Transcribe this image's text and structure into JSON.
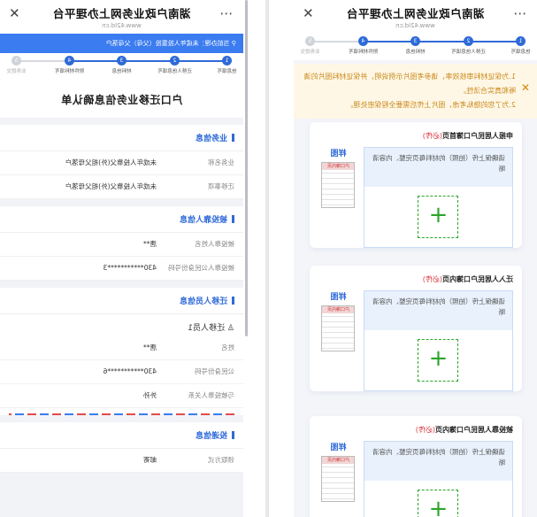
{
  "app": {
    "title": "湖南户政业务网上办理平台",
    "url": "www.42ld.cn"
  },
  "steps": [
    {
      "num": "1",
      "label": "信息填写",
      "done": true
    },
    {
      "num": "2",
      "label": "迁移人信息填写",
      "done": true
    },
    {
      "num": "3",
      "label": "材料信息",
      "done": true
    },
    {
      "num": "4",
      "label": "附件材料填写",
      "done": true
    },
    {
      "num": "5",
      "label": "业务提交",
      "done": false
    }
  ],
  "left": {
    "notice": [
      "1.为保证材料审核效率，请参考图片示例说明，并保证材料图片的清晰和真实合法性。",
      "2.为了您的隐私考虑，图片上传后需要全程保密处理。"
    ],
    "cards": [
      {
        "title": "申报人居民户口簿首页",
        "req": "(必传)",
        "hint": "请确保上传（拍照）的材料每页完整、内容清晰",
        "sample": "样图",
        "doc": "户口簿内页"
      },
      {
        "title": "迁入人居民户口簿内页",
        "req": "(必传)",
        "hint": "请确保上传（拍照）的材料每页完整、内容清晰",
        "sample": "样图",
        "doc": "户口簿内页"
      },
      {
        "title": "被投靠人居民户口簿内页",
        "req": "(必传)",
        "hint": "请确保上传（拍照）的材料每页完整、内容清晰",
        "sample": "样图",
        "doc": "户口簿内页"
      }
    ]
  },
  "right": {
    "current": "当前办理：未成年人投靠投（父母）父母落户",
    "title": "户口迁移业务信息确认单",
    "business": {
      "header": "业务信息",
      "rows": [
        {
          "k": "业务名称",
          "v": "未成年人投靠父(外)祖父母落户"
        },
        {
          "k": "迁移事项",
          "v": "未成年人投靠父(外)祖父母落户"
        }
      ]
    },
    "host": {
      "header": "被投靠人信息",
      "rows": [
        {
          "k": "被投靠人姓名",
          "v": "唐**"
        },
        {
          "k": "被投靠人公民身份号码",
          "v": "430***********3"
        }
      ]
    },
    "movers": {
      "header": "迁移人员信息",
      "person": "迁移人员1",
      "rows": [
        {
          "k": "姓名",
          "v": "唐**"
        },
        {
          "k": "公民身份号码",
          "v": "430***********6"
        },
        {
          "k": "与被投靠人关系",
          "v": "外孙"
        }
      ]
    },
    "delivery": {
      "header": "投递信息",
      "rows": [
        {
          "k": "领取方式",
          "v": "邮寄"
        }
      ]
    }
  }
}
